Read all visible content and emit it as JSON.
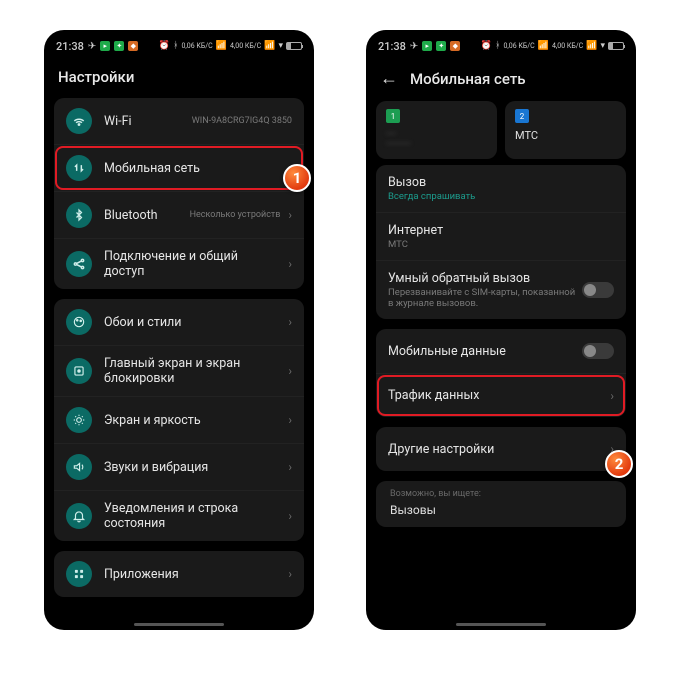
{
  "status": {
    "time": "21:38",
    "net1": "0,06\nКБ/С",
    "net2": "4,00\nКБ/С",
    "battery_pct": 30
  },
  "left": {
    "title": "Настройки",
    "wifi": {
      "label": "Wi-Fi",
      "value": "WIN-9A8CRG7IG4Q 3850"
    },
    "mobile": {
      "label": "Мобильная сеть"
    },
    "bluetooth": {
      "label": "Bluetooth",
      "value": "Несколько устройств"
    },
    "tether": {
      "label": "Подключение и общий доступ"
    },
    "wallpaper": {
      "label": "Обои и стили"
    },
    "home": {
      "label": "Главный экран и экран блокировки"
    },
    "display": {
      "label": "Экран и яркость"
    },
    "sound": {
      "label": "Звуки и вибрация"
    },
    "notif": {
      "label": "Уведомления и строка состояния"
    },
    "apps": {
      "label": "Приложения"
    }
  },
  "right": {
    "title": "Мобильная сеть",
    "sim1": {
      "num": "1",
      "label": "----",
      "sub": "----------"
    },
    "sim2": {
      "num": "2",
      "label": "МТС"
    },
    "call": {
      "label": "Вызов",
      "value": "Всегда спрашивать"
    },
    "internet": {
      "label": "Интернет",
      "value": "МТС"
    },
    "callback": {
      "label": "Умный обратный вызов",
      "sub": "Перезванивайте с SIM-карты, показанной в журнале вызовов."
    },
    "mdata": {
      "label": "Мобильные данные"
    },
    "traffic": {
      "label": "Трафик данных"
    },
    "other": {
      "label": "Другие настройки"
    },
    "search": {
      "hint": "Возможно, вы ищете:",
      "value": "Вызовы"
    }
  },
  "markers": {
    "1": "1",
    "2": "2"
  }
}
